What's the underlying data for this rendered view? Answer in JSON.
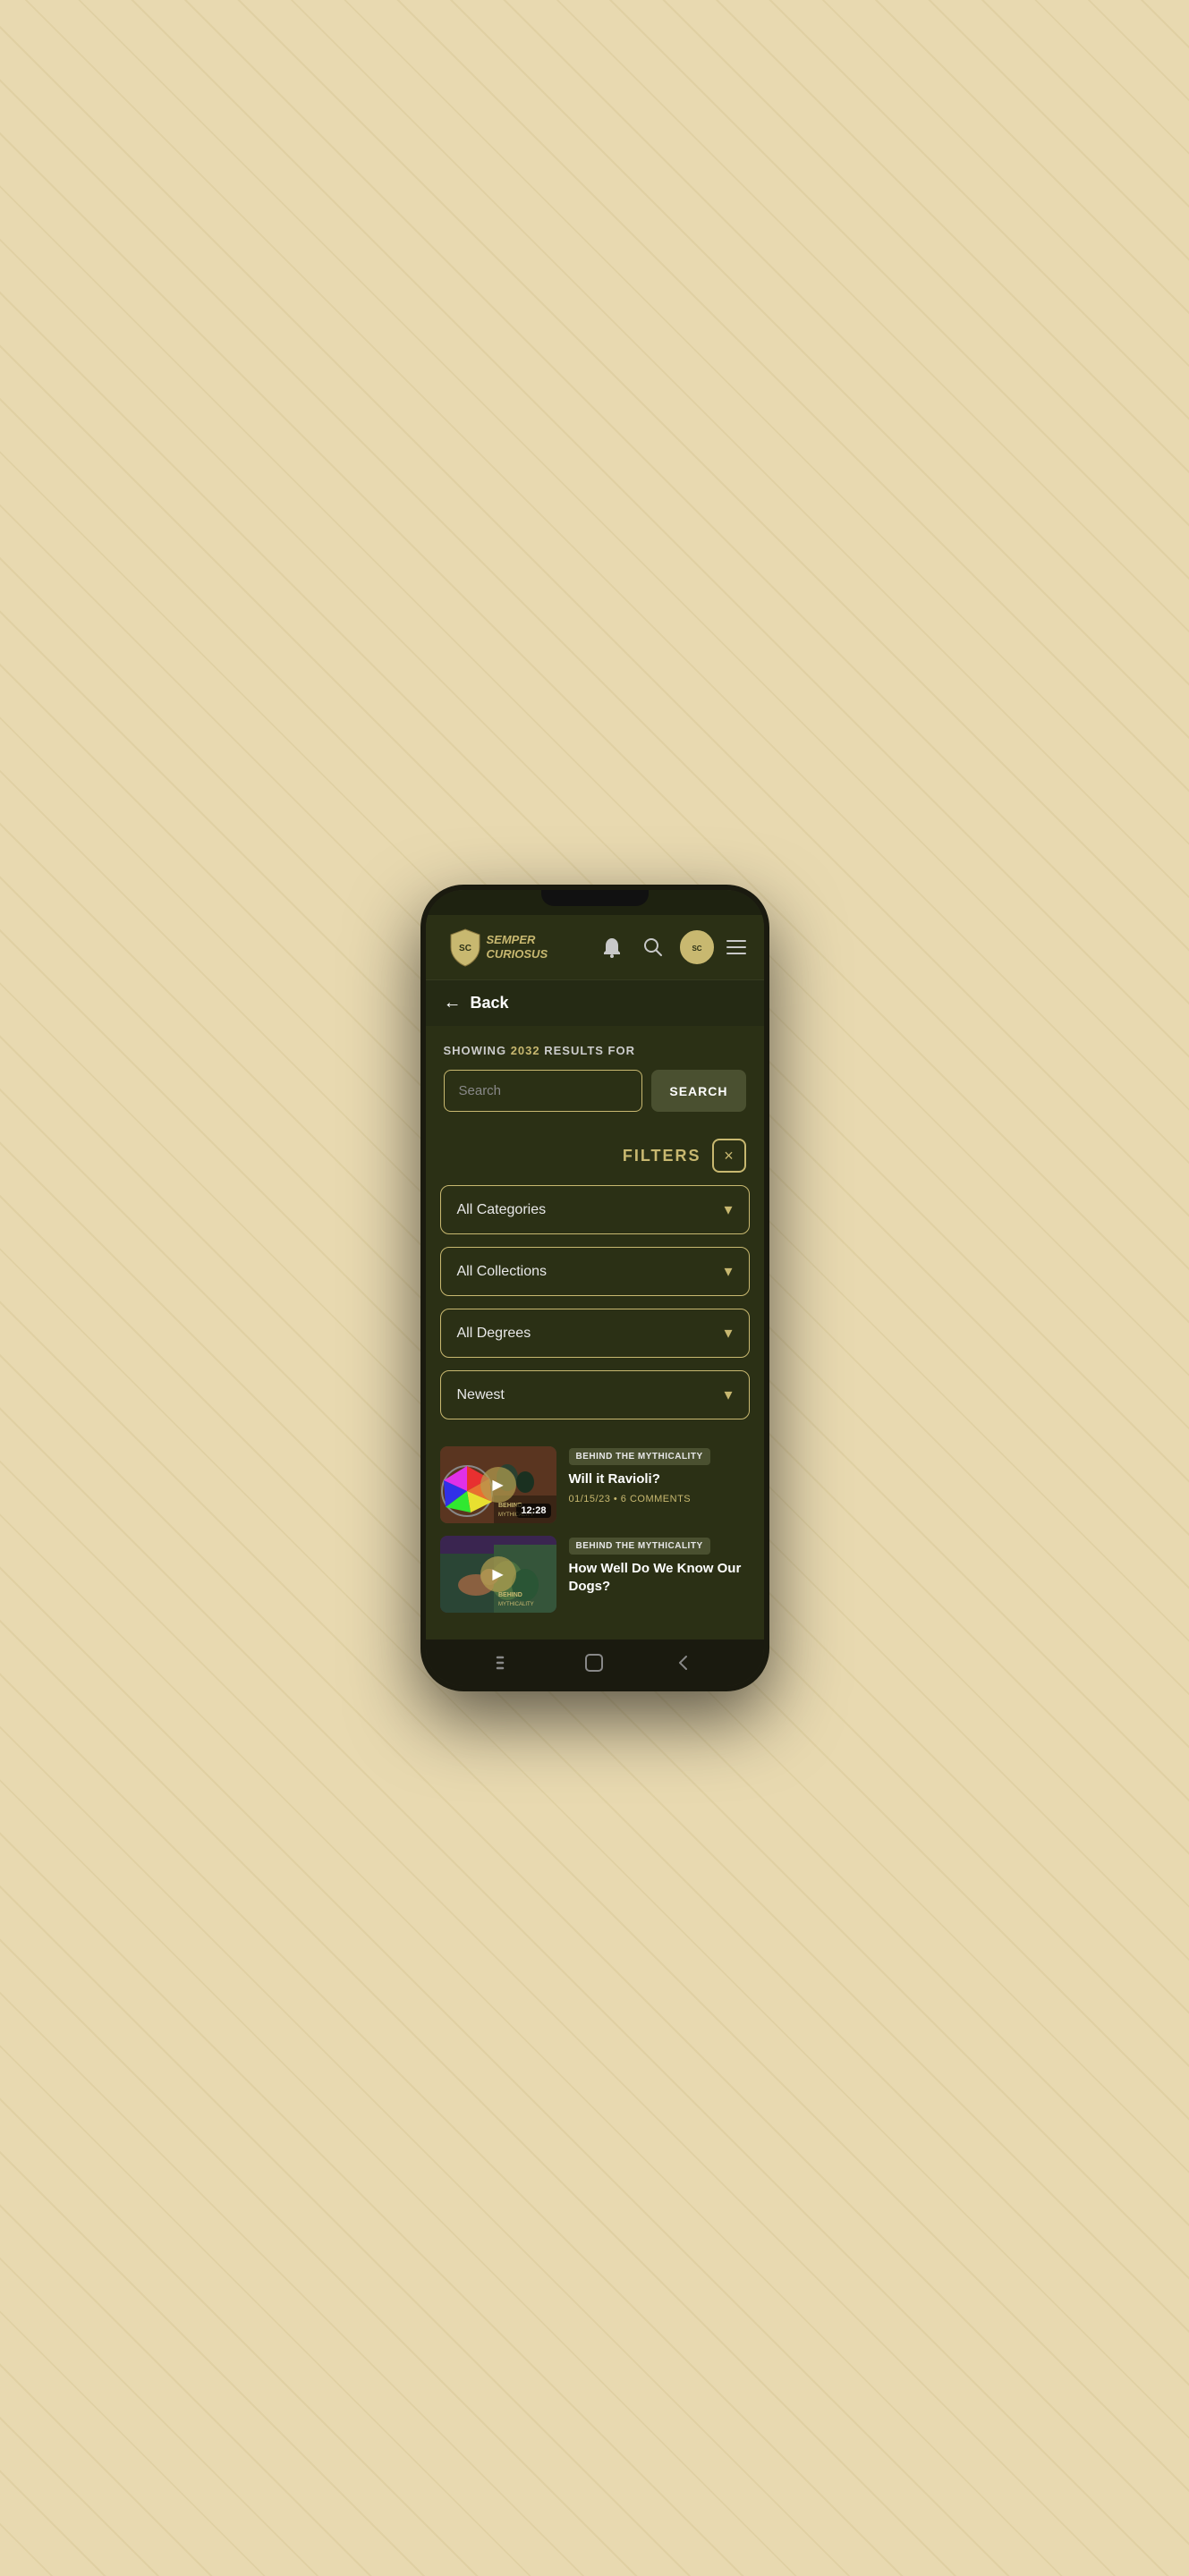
{
  "app": {
    "logo_line1": "SEMPER",
    "logo_line2": "CURIOSUS"
  },
  "header": {
    "back_label": "Back"
  },
  "search_section": {
    "showing_prefix": "SHOWING",
    "result_count": "2032",
    "showing_suffix": "RESULTS FOR",
    "search_placeholder": "Search",
    "search_button_label": "SEARCH"
  },
  "filters": {
    "label": "FILTERS",
    "close_icon": "×",
    "dropdowns": [
      {
        "label": "All Categories",
        "value": "all_categories"
      },
      {
        "label": "All Collections",
        "value": "all_collections"
      },
      {
        "label": "All Degrees",
        "value": "all_degrees"
      },
      {
        "label": "Newest",
        "value": "newest"
      }
    ]
  },
  "results": [
    {
      "tag": "BEHIND THE MYTHICALITY",
      "title": "Will it Ravioli?",
      "date": "01/15/23",
      "comments": "6 COMMENTS",
      "duration": "12:28",
      "watermark": "BEHIND\nMYTHICALITY",
      "thumb_class": "thumb-bg-1"
    },
    {
      "tag": "BEHIND THE MYTHICALITY",
      "title": "How Well Do We Know Our Dogs?",
      "date": "",
      "comments": "",
      "duration": "",
      "watermark": "BEHIND\nMYTHICALITY",
      "thumb_class": "thumb-bg-2"
    }
  ],
  "bottom_nav": {
    "back_icon": "◁",
    "home_icon": "○",
    "menu_icon": "|||"
  }
}
